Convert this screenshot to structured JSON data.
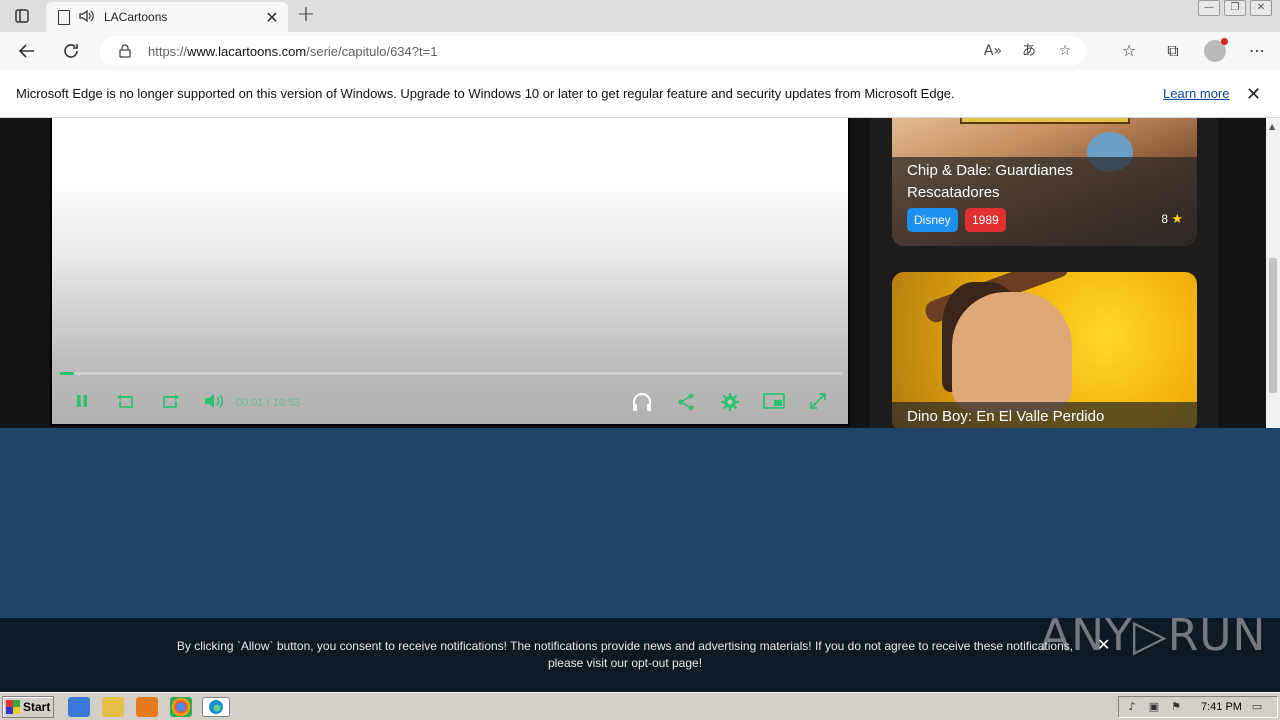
{
  "browser": {
    "tab": {
      "title": "LACartoons",
      "close": "✕"
    },
    "new_tab": "+",
    "url": {
      "prefix": "https://",
      "host": "www.lacartoons.com",
      "path": "/serie/capitulo/634?t=1"
    },
    "window_controls": [
      "—",
      "❐",
      "✕"
    ]
  },
  "infobar": {
    "message": "Microsoft Edge is no longer supported on this version of Windows. Upgrade to Windows 10 or later to get regular feature and security updates from Microsoft Edge.",
    "link": "Learn more",
    "close": "✕"
  },
  "player": {
    "progress": 0.018,
    "accent": "#2fbf71",
    "time": "00:01 / 10:53",
    "icons": [
      "pause-icon",
      "rewind-icon",
      "forward-icon",
      "volume-icon",
      "headphones-icon",
      "share-icon",
      "settings-icon",
      "pip-icon",
      "fullscreen-icon"
    ]
  },
  "sidebar": {
    "cards": [
      {
        "title": "Chip & Dale: Guardianes Rescatadores",
        "studio": "Disney",
        "year": "1989",
        "rating": "8"
      },
      {
        "title": "Dino Boy: En El Valle Perdido"
      }
    ]
  },
  "notification": {
    "line1": "By clicking `Allow` button, you consent to receive notifications! The notifications provide news and advertising materials! If you do not agree to receive these notifications,",
    "line2_prefix": "please visit our ",
    "line2_link": "opt-out page",
    "line2_suffix": "!",
    "close": "✕",
    "watermark": "ANY▷RUN"
  },
  "taskbar": {
    "start": "Start",
    "clock": "7:41 PM"
  }
}
